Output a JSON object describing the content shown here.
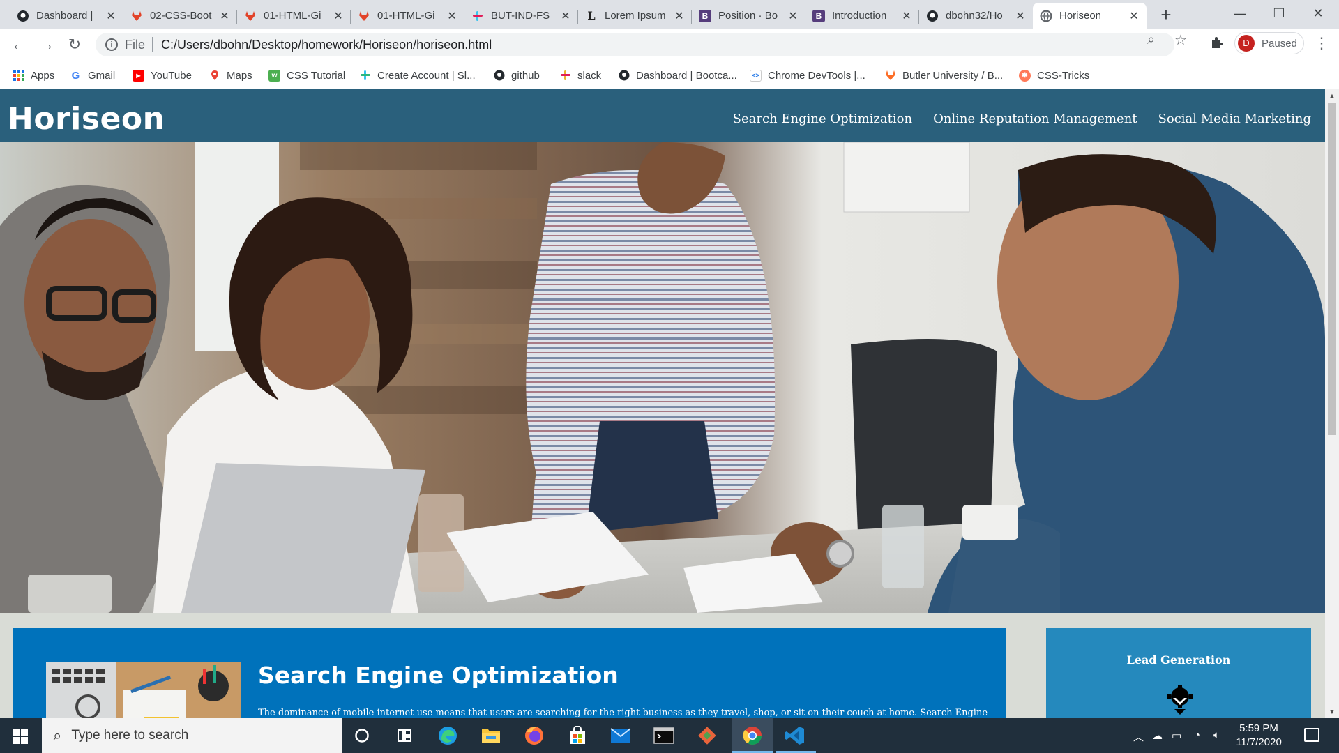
{
  "browser": {
    "tabs": [
      {
        "title": "Dashboard |",
        "icon": "github-icon",
        "active": false
      },
      {
        "title": "02-CSS-Boot",
        "icon": "gitlab-icon",
        "active": false
      },
      {
        "title": "01-HTML-Gi",
        "icon": "gitlab-icon",
        "active": false
      },
      {
        "title": "01-HTML-Gi",
        "icon": "gitlab-icon",
        "active": false
      },
      {
        "title": "BUT-IND-FS",
        "icon": "slack-icon",
        "active": false
      },
      {
        "title": "Lorem Ipsum",
        "icon": "lorem-icon",
        "active": false
      },
      {
        "title": "Position · Bo",
        "icon": "bootstrap-icon",
        "active": false
      },
      {
        "title": "Introduction",
        "icon": "bootstrap-icon",
        "active": false
      },
      {
        "title": "dbohn32/Ho",
        "icon": "github-icon",
        "active": false
      },
      {
        "title": "Horiseon",
        "icon": "globe-icon",
        "active": true
      }
    ],
    "address": {
      "scheme_label": "File",
      "url": "C:/Users/dbohn/Desktop/homework/Horiseon/horiseon.html"
    },
    "profile": {
      "initial": "D",
      "status": "Paused"
    },
    "bookmarks": [
      {
        "label": "Apps",
        "icon": "apps-grid-icon"
      },
      {
        "label": "Gmail",
        "icon": "google-icon"
      },
      {
        "label": "YouTube",
        "icon": "youtube-icon"
      },
      {
        "label": "Maps",
        "icon": "maps-icon"
      },
      {
        "label": "CSS Tutorial",
        "icon": "w3schools-icon"
      },
      {
        "label": "Create Account | Sl...",
        "icon": "slack-icon"
      },
      {
        "label": "github",
        "icon": "github-icon"
      },
      {
        "label": "slack",
        "icon": "slack-icon"
      },
      {
        "label": "Dashboard | Bootca...",
        "icon": "github-icon"
      },
      {
        "label": "Chrome DevTools |...",
        "icon": "devtools-icon"
      },
      {
        "label": "Butler University / B...",
        "icon": "gitlab-icon"
      },
      {
        "label": "CSS-Tricks",
        "icon": "css-tricks-icon"
      }
    ]
  },
  "page": {
    "logo": "Horiseon",
    "nav": [
      "Search Engine Optimization",
      "Online Reputation Management",
      "Social Media Marketing"
    ],
    "hero_image": "team-meeting-photo",
    "section": {
      "title": "Search Engine Optimization",
      "text": "The dominance of mobile internet use means that users are searching for the right business as they travel, shop, or sit on their couch at home. Search Engine"
    },
    "sidebar": {
      "title": "Lead Generation",
      "icon": "lead-generation-icon"
    }
  },
  "taskbar": {
    "search_placeholder": "Type here to search",
    "apps": [
      "cortana-icon",
      "task-view-icon",
      "edge-icon",
      "file-explorer-icon",
      "firefox-icon",
      "store-icon",
      "mail-icon",
      "terminal-icon",
      "git-icon",
      "chrome-icon",
      "vscode-icon"
    ],
    "time": "5:59 PM",
    "date": "11/7/2020"
  },
  "colors": {
    "header": "#2a607c",
    "section": "#0072bb",
    "sidebar": "#2589bd",
    "page_bg": "#d9dcd6"
  }
}
